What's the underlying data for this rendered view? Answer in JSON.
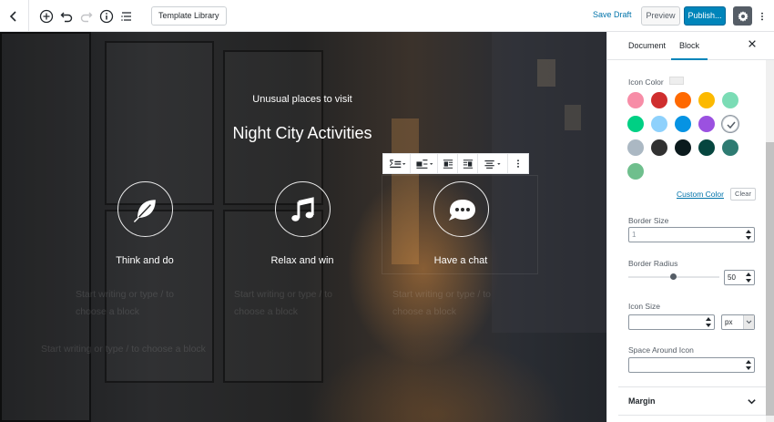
{
  "toolbar": {
    "template_library_label": "Template Library",
    "save_draft_label": "Save Draft",
    "preview_label": "Preview",
    "publish_label": "Publish..."
  },
  "content": {
    "subtitle": "Unusual places to visit",
    "title": "Night City Activities",
    "features": [
      {
        "label": "Think and do",
        "icon": "leaf-icon"
      },
      {
        "label": "Relax and win",
        "icon": "music-note-icon"
      },
      {
        "label": "Have a chat",
        "icon": "chat-bubble-icon"
      }
    ],
    "placeholder_line1": "Start writing or type / to",
    "placeholder_line2": "choose a block",
    "placeholder_full": "Start writing or type / to choose a block"
  },
  "sidebar": {
    "tabs": [
      "Document",
      "Block"
    ],
    "active_tab": "Block",
    "icon_color_label": "Icon Color",
    "colors": [
      "#f78da7",
      "#cf2e2e",
      "#ff6900",
      "#fcb900",
      "#7bdcb5",
      "#00d084",
      "#8ed1fc",
      "#0693e3",
      "#9b51e0",
      "#ffffff",
      "#abb8c3",
      "#313131",
      "#0b1a1d",
      "#06463f",
      "#2e7b72",
      "#6fbf8d"
    ],
    "selected_color_index": 9,
    "custom_color_label": "Custom Color",
    "clear_label": "Clear",
    "border_size_label": "Border Size",
    "border_size_value": "1",
    "border_radius_label": "Border Radius",
    "border_radius_value": "50",
    "icon_size_label": "Icon Size",
    "icon_size_value": "",
    "icon_size_unit": "px",
    "space_around_label": "Space Around Icon",
    "space_around_value": "",
    "margin_label": "Margin"
  }
}
